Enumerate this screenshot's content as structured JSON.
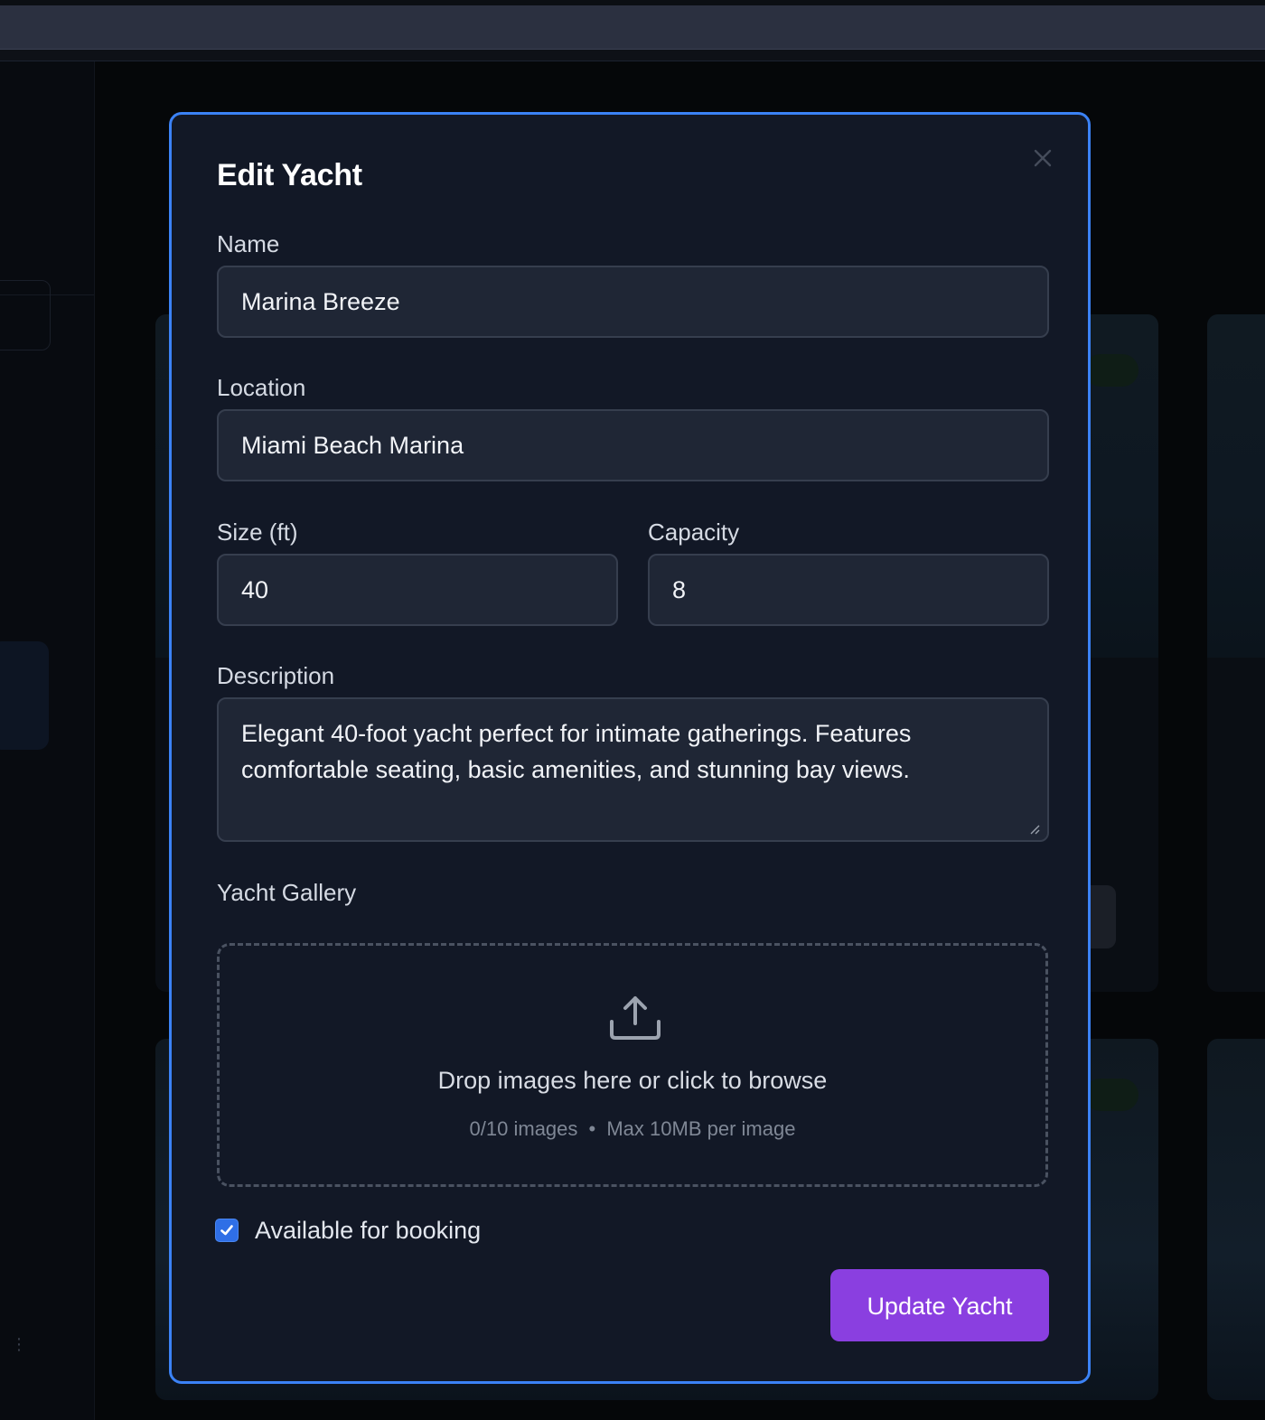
{
  "modal": {
    "title": "Edit Yacht",
    "close_icon": "close-icon",
    "name": {
      "label": "Name",
      "value": "Marina Breeze"
    },
    "location": {
      "label": "Location",
      "value": "Miami Beach Marina"
    },
    "size": {
      "label": "Size (ft)",
      "value": "40"
    },
    "capacity": {
      "label": "Capacity",
      "value": "8"
    },
    "description": {
      "label": "Description",
      "value": "Elegant 40-foot yacht perfect for intimate gatherings. Features comfortable seating, basic amenities, and stunning bay views."
    },
    "gallery": {
      "label": "Yacht Gallery",
      "icon": "upload-icon",
      "drop_text": "Drop images here or click to browse",
      "count_text": "0/10 images",
      "separator": "•",
      "limit_text": "Max 10MB per image"
    },
    "available": {
      "label": "Available for booking",
      "checked": true
    },
    "submit_label": "Update Yacht"
  },
  "colors": {
    "accent_border": "#3b82f6",
    "submit_button": "#8a3fe0",
    "checkbox": "#2f6fe6",
    "modal_bg": "#121826",
    "field_bg": "#1f2635"
  }
}
